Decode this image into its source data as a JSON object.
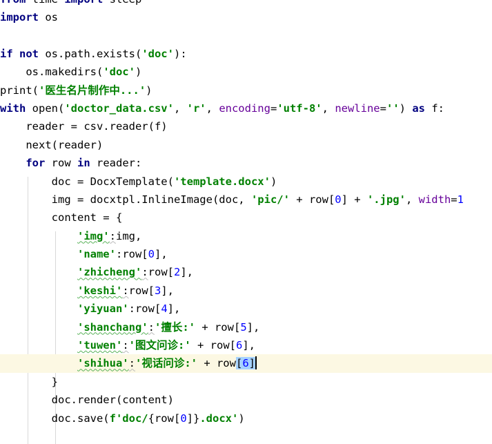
{
  "editor": {
    "name": "python-code-editor",
    "language": "Python",
    "background_color": "#ffffff",
    "current_line_highlight_color": "#fcf8e3",
    "selection_color": "#a6d2ff",
    "caret_color": "#000000",
    "indent_guide_color": "#d8d8d8",
    "syntax_colors": {
      "keyword": "#000080",
      "string": "#008000",
      "number": "#0000ff",
      "keyword_argument": "#660099",
      "plain": "#000000",
      "spellcheck_squiggle": "#59b259"
    },
    "indent_guides_x": [
      40,
      80
    ],
    "caret_line_index": 15,
    "selection_text": "6"
  },
  "code": {
    "lines": [
      {
        "id": "line-1",
        "indent": 0,
        "clipped_top": true,
        "text": "from time import sleep"
      },
      {
        "id": "line-2",
        "indent": 0,
        "text": "import os"
      },
      {
        "id": "line-3",
        "indent": 0,
        "text": ""
      },
      {
        "id": "line-4",
        "indent": 0,
        "text": "if not os.path.exists('doc'):"
      },
      {
        "id": "line-5",
        "indent": 1,
        "text": "    os.makedirs('doc')"
      },
      {
        "id": "line-6",
        "indent": 0,
        "text": "print('医生名片制作中...')"
      },
      {
        "id": "line-7",
        "indent": 0,
        "text": "with open('doctor_data.csv', 'r', encoding='utf-8', newline='') as f:"
      },
      {
        "id": "line-8",
        "indent": 1,
        "text": "    reader = csv.reader(f)"
      },
      {
        "id": "line-9",
        "indent": 1,
        "text": "    next(reader)"
      },
      {
        "id": "line-10",
        "indent": 1,
        "text": "    for row in reader:"
      },
      {
        "id": "line-11",
        "indent": 2,
        "text": "        doc = DocxTemplate('template.docx')"
      },
      {
        "id": "line-12",
        "indent": 2,
        "clipped_right": true,
        "text": "        img = docxtpl.InlineImage(doc, 'pic/' + row[0] + '.jpg', width="
      },
      {
        "id": "line-13",
        "indent": 2,
        "text": "        content = {"
      },
      {
        "id": "line-14",
        "indent": 3,
        "text": "            'img':img,"
      },
      {
        "id": "line-15",
        "indent": 3,
        "text": "            'name':row[0],"
      },
      {
        "id": "line-16",
        "indent": 3,
        "text": "            'zhicheng':row[2],"
      },
      {
        "id": "line-17",
        "indent": 3,
        "text": "            'keshi':row[3],"
      },
      {
        "id": "line-18",
        "indent": 3,
        "text": "            'yiyuan':row[4],"
      },
      {
        "id": "line-19",
        "indent": 3,
        "text": "            'shanchang':'擅长:' + row[5],"
      },
      {
        "id": "line-20",
        "indent": 3,
        "text": "            'tuwen':'图文问诊:' + row[6],"
      },
      {
        "id": "line-21",
        "indent": 3,
        "highlighted": true,
        "text": "            'shihua':'视话问诊:' + row[6]"
      },
      {
        "id": "line-22",
        "indent": 2,
        "text": "        }"
      },
      {
        "id": "line-23",
        "indent": 2,
        "text": "        doc.render(content)"
      },
      {
        "id": "line-24",
        "indent": 2,
        "clipped_bottom": true,
        "text": "        doc.save(f'doc/{row[0]}.docx')"
      }
    ]
  }
}
